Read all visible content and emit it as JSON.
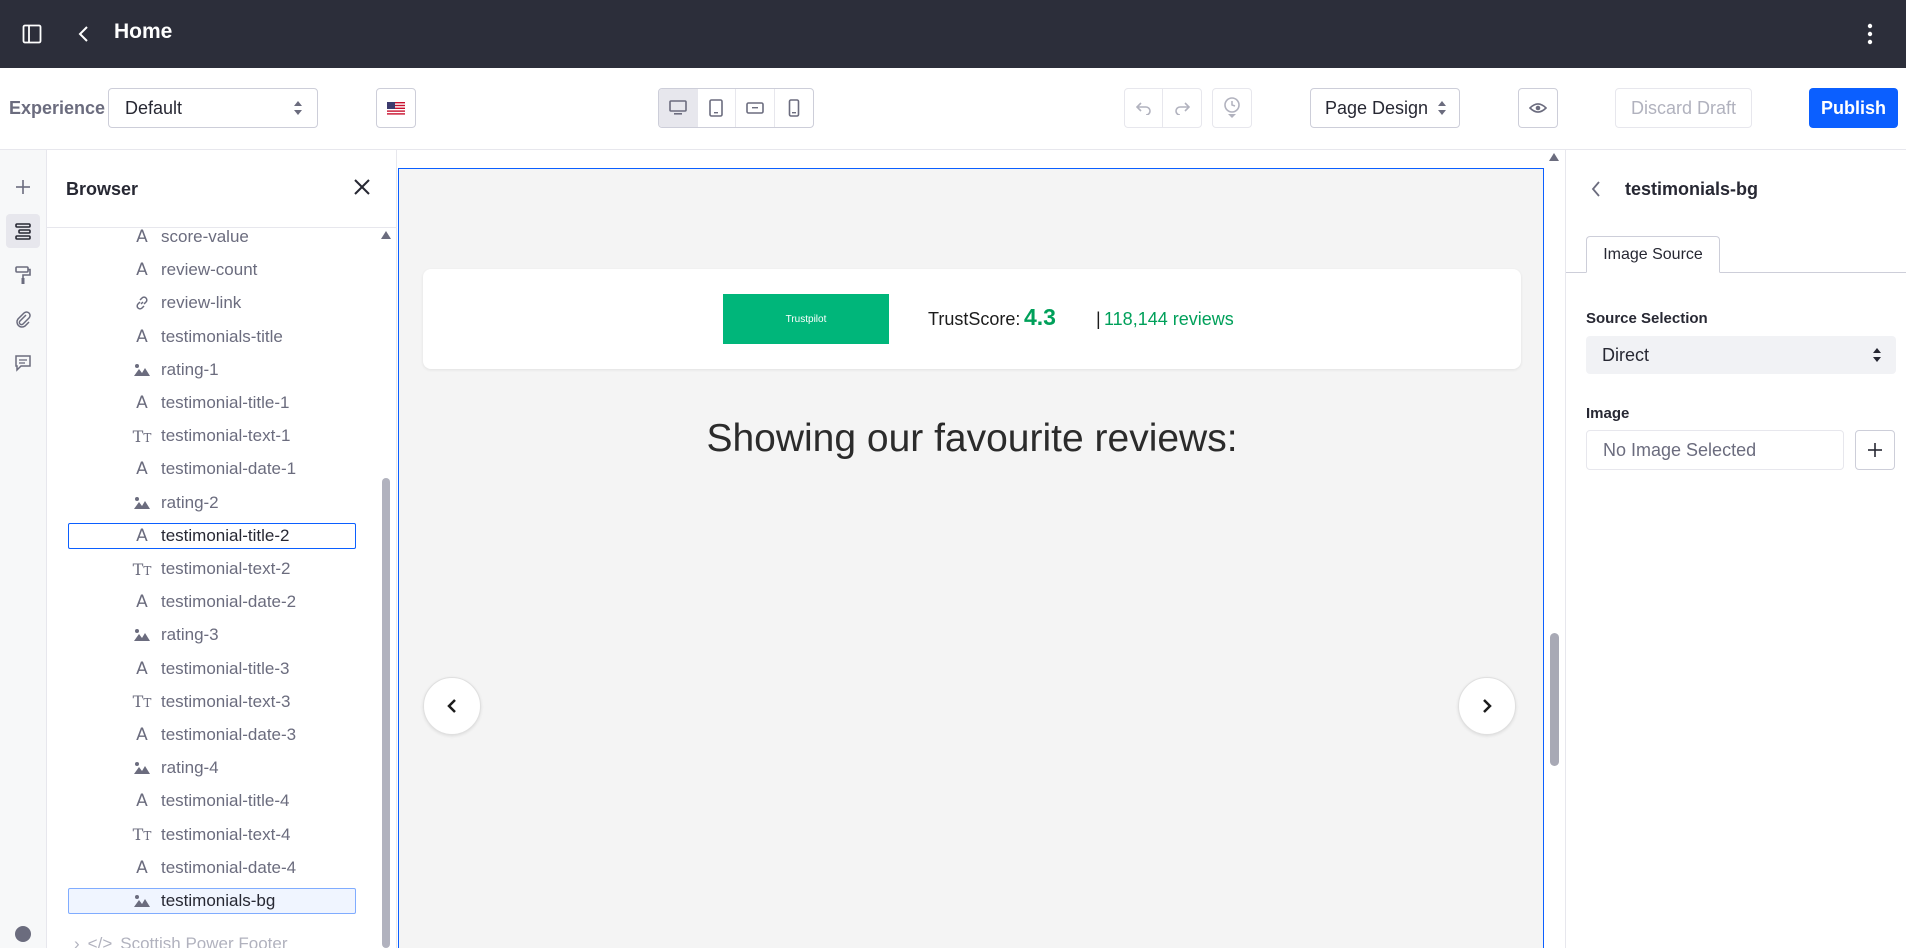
{
  "topbar": {
    "title": "Home"
  },
  "toolbar": {
    "experience_label": "Experience",
    "experience_value": "Default",
    "page_design_value": "Page Design",
    "discard_label": "Discard Draft",
    "publish_label": "Publish",
    "colors": {
      "publish_bg": "#0b5fff",
      "topbar_bg": "#2c2e3a"
    }
  },
  "browser": {
    "title": "Browser",
    "items": [
      {
        "icon": "text-icon",
        "label": "score-value"
      },
      {
        "icon": "text-icon",
        "label": "review-count"
      },
      {
        "icon": "link-icon",
        "label": "review-link"
      },
      {
        "icon": "text-icon",
        "label": "testimonials-title"
      },
      {
        "icon": "image-icon",
        "label": "rating-1"
      },
      {
        "icon": "text-icon",
        "label": "testimonial-title-1"
      },
      {
        "icon": "rich-text-icon",
        "label": "testimonial-text-1"
      },
      {
        "icon": "text-icon",
        "label": "testimonial-date-1"
      },
      {
        "icon": "image-icon",
        "label": "rating-2"
      },
      {
        "icon": "text-icon",
        "label": "testimonial-title-2"
      },
      {
        "icon": "rich-text-icon",
        "label": "testimonial-text-2"
      },
      {
        "icon": "text-icon",
        "label": "testimonial-date-2"
      },
      {
        "icon": "image-icon",
        "label": "rating-3"
      },
      {
        "icon": "text-icon",
        "label": "testimonial-title-3"
      },
      {
        "icon": "rich-text-icon",
        "label": "testimonial-text-3"
      },
      {
        "icon": "text-icon",
        "label": "testimonial-date-3"
      },
      {
        "icon": "image-icon",
        "label": "rating-4"
      },
      {
        "icon": "text-icon",
        "label": "testimonial-title-4"
      },
      {
        "icon": "rich-text-icon",
        "label": "testimonial-text-4"
      },
      {
        "icon": "text-icon",
        "label": "testimonial-date-4"
      },
      {
        "icon": "image-icon",
        "label": "testimonials-bg"
      }
    ],
    "footer_item": "Scottish Power Footer"
  },
  "canvas": {
    "trustpilot_logo": "Trustpilot",
    "trustscore_label": "TrustScore:",
    "trustscore_value": "4.3",
    "separator": "|",
    "review_count": "118,144 reviews",
    "heading": "Showing our favourite reviews:",
    "colors": {
      "trustpilot_green": "#00b67a",
      "score_green": "#00a05a"
    }
  },
  "rightpanel": {
    "title": "testimonials-bg",
    "tab": "Image Source",
    "source_label": "Source Selection",
    "source_value": "Direct",
    "image_label": "Image",
    "image_value": "No Image Selected"
  }
}
